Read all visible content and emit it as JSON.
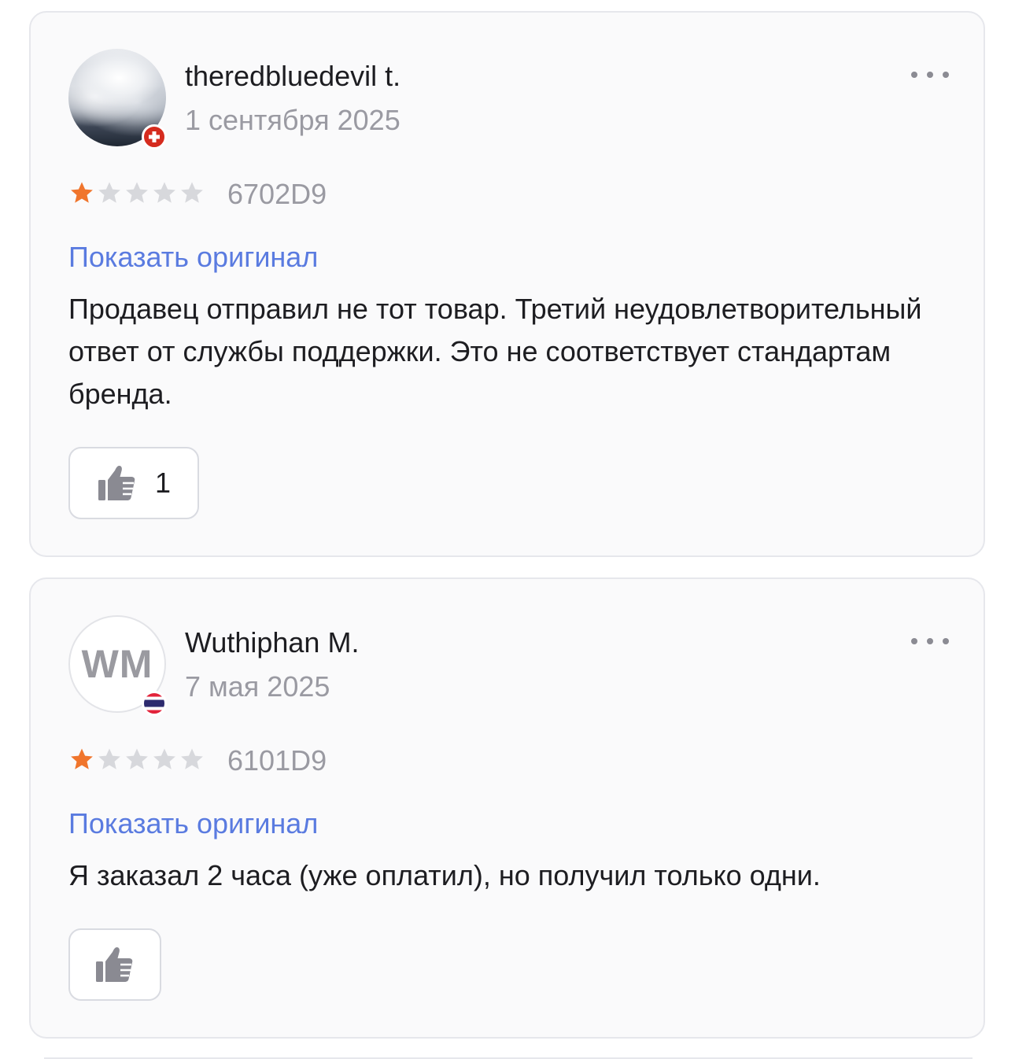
{
  "reviews": [
    {
      "author": "theredbluedevil t.",
      "date": "1 сентября 2025",
      "avatar": "photo",
      "flag": "switzerland",
      "rating": 1,
      "max_rating": 5,
      "code": "6702D9",
      "show_original": "Показать оригинал",
      "text": "Продавец отправил не тот товар. Третий неудовлетворительный ответ от службы поддержки. Это не соответствует стандартам бренда.",
      "likes": "1"
    },
    {
      "author": "Wuthiphan M.",
      "date": "7 мая 2025",
      "avatar_initials": "WM",
      "flag": "thailand",
      "rating": 1,
      "max_rating": 5,
      "code": "6101D9",
      "show_original": "Показать оригинал",
      "text": "Я заказал 2 часа (уже оплатил), но получил только одни.",
      "likes": ""
    }
  ],
  "colors": {
    "star_filled": "#f0752c",
    "star_empty": "#d7d8dc",
    "link": "#5a7be0",
    "card_bg": "#fafafb"
  },
  "icons": [
    "more-options-icon",
    "thumbs-up-icon",
    "star-icon",
    "flag-icon"
  ]
}
